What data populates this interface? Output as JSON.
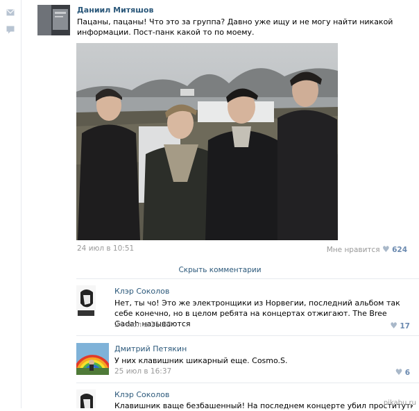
{
  "post": {
    "author": "Даниил Митяшов",
    "text": "Пацаны, пацаны! Что это за группа? Давно уже ищу и не могу найти никакой информации. Пост-панк какой то по моему.",
    "timestamp": "24 июл в 10:51",
    "likes_label": "Мне нравится",
    "likes_count": "624"
  },
  "hide_comments_label": "Скрыть комментарии",
  "comments": [
    {
      "author": "Клэр Соколов",
      "text": "Нет, ты чо! Это же электронщики из Норвегии, последний альбом так себе конечно, но в целом ребята на концертах отжигают. The Bree Gadah называются",
      "timestamp": "24 июл в 11:23",
      "likes": "17"
    },
    {
      "author": "Дмитрий Петякин",
      "text": "У них клавишник шикарный еще. Cosmo.S.",
      "timestamp": "25 июл в 16:37",
      "likes": "6"
    },
    {
      "author": "Клэр Соколов",
      "text": "Клавишник ваще безбашенный! На последнем концерте убил проститутку, откусив ей",
      "timestamp": "",
      "likes": ""
    }
  ],
  "watermark": "pikabu.ru",
  "colors": {
    "link": "#2b587a",
    "meta": "#999999",
    "like_num": "#6b8ab0"
  },
  "icons": {
    "sidebar_1": "mail-icon",
    "sidebar_2": "comment-icon",
    "like": "heart-icon"
  }
}
